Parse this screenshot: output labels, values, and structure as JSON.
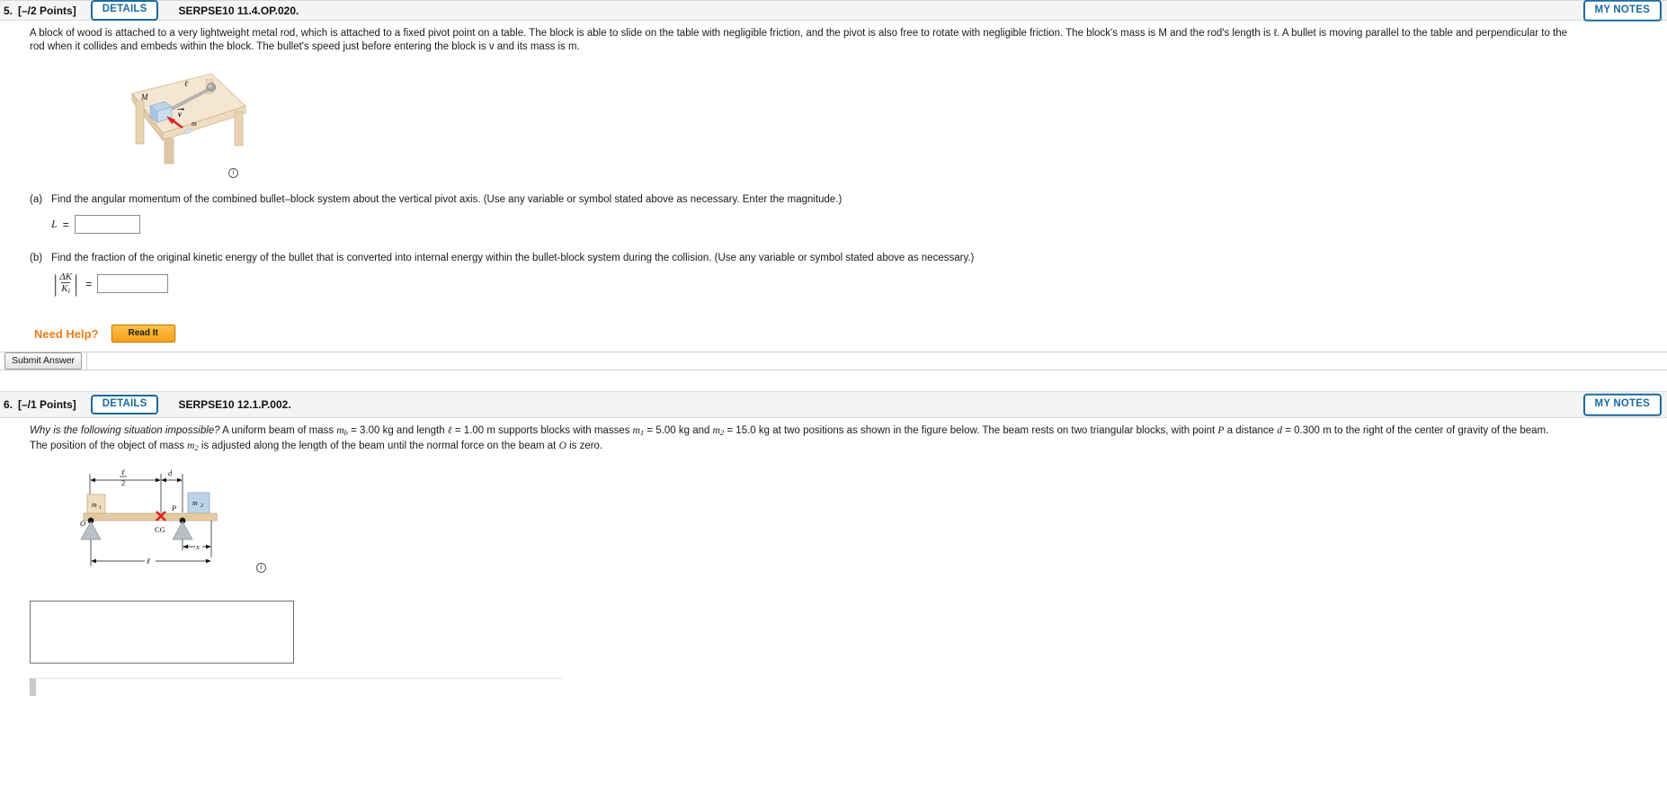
{
  "questions": [
    {
      "number": "5.",
      "points": "[–/2 Points]",
      "details_label": "DETAILS",
      "code": "SERPSE10 11.4.OP.020.",
      "my_notes_label": "MY NOTES",
      "stem_line1": "A block of wood is attached to a very lightweight metal rod, which is attached to a fixed pivot point on a table. The block is able to slide on the table with negligible friction, and the pivot is also free to rotate with negligible friction. The block's mass is M and the rod's length is ℓ. A bullet is moving parallel to the table and perpendicular to the",
      "stem_line2": "rod when it collides and embeds within the block. The bullet's speed just before entering the block is v and its mass is m.",
      "figure": {
        "name": "block-rod-table-figure",
        "labels": {
          "block_mass": "M",
          "rod_length": "ℓ",
          "velocity": "v",
          "bullet_mass": "m"
        },
        "info_icon": "info-icon"
      },
      "parts": [
        {
          "letter": "(a)",
          "text": "Find the angular momentum of the combined bullet–block system about the vertical pivot axis. (Use any variable or symbol stated above as necessary. Enter the magnitude.)",
          "answer_label": "L",
          "equals": "=",
          "answer_value": "",
          "answer_type": "plain"
        },
        {
          "letter": "(b)",
          "text": "Find the fraction of the original kinetic energy of the bullet that is converted into internal energy within the bullet-block system during the collision. (Use any variable or symbol stated above as necessary.)",
          "answer_label_numerator": "ΔK",
          "answer_label_denominator": "K",
          "answer_label_denominator_sub": "i",
          "equals": "=",
          "answer_value": "",
          "answer_type": "fraction"
        }
      ],
      "need_help_label": "Need Help?",
      "read_it_label": "Read It",
      "submit_label": "Submit Answer"
    },
    {
      "number": "6.",
      "points": "[–/1 Points]",
      "details_label": "DETAILS",
      "code": "SERPSE10 12.1.P.002.",
      "my_notes_label": "MY NOTES",
      "stem_italic_lead": "Why is the following situation impossible?",
      "stem_line1_rest": " A uniform beam of mass m_b = 3.00 kg and length ℓ = 1.00 m supports blocks with masses m_1 = 5.00 kg and m_2 = 15.0 kg at two positions as shown in the figure below. The beam rests on two triangular blocks, with point P a distance d = 0.300 m to the right of the center of gravity of the beam.",
      "stem_line2": "The position of the object of mass m_2 is adjusted along the length of the beam until the normal force on the beam at O is zero.",
      "figure": {
        "name": "beam-balance-figure",
        "labels": {
          "mass1": "m₁",
          "mass2": "m₂",
          "half_length_num": "ℓ",
          "half_length_den": "2",
          "distance_d": "d",
          "point_P": "P",
          "point_O": "O",
          "center_of_gravity": "CG",
          "distance_x": "x",
          "total_length": "ℓ"
        },
        "info_icon": "info-icon"
      },
      "essay_value": "",
      "essay_placeholder": ""
    }
  ]
}
